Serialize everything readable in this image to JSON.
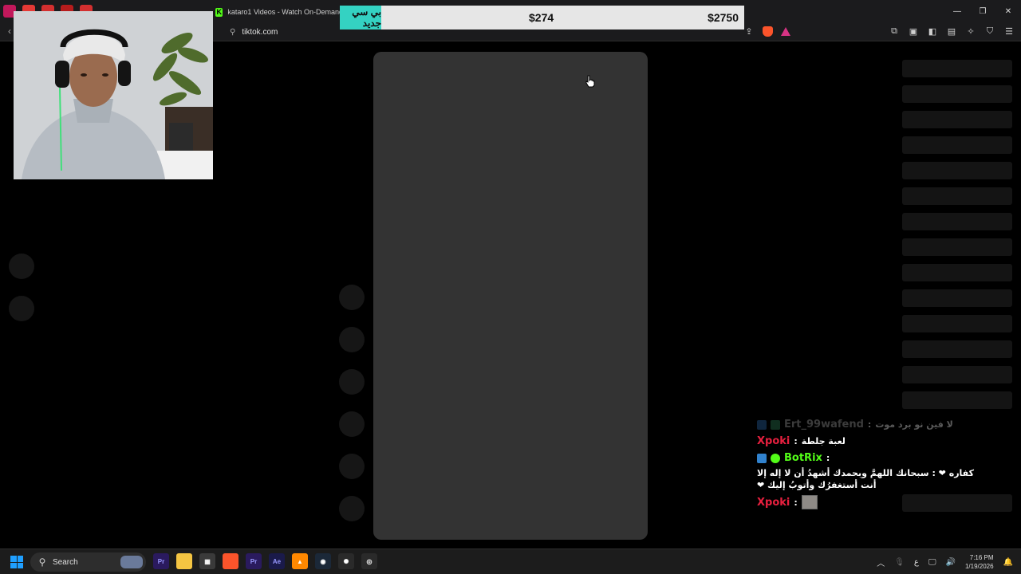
{
  "browser": {
    "active_tab_title": "kataro1 Videos - Watch On-Demand",
    "url": "tiktok.com"
  },
  "donation_bar": {
    "label": "بي سي جديد",
    "current": "$274",
    "goal": "$2750"
  },
  "chat": {
    "messages": [
      {
        "user": "Ert_99wafend",
        "text": "لا فين نو برد موت",
        "faded": true
      },
      {
        "user": "Xpoki",
        "text": "لعبة جلطة"
      },
      {
        "user": "BotRix",
        "text": "كفاره ❤ : سبحانك اللهمَّ وبحمدك أشهدُ أن لا إله إلا",
        "text2": "أنت أستغفرُك وأتوبُ إليك ❤"
      },
      {
        "user": "Xpoki",
        "text": ""
      }
    ]
  },
  "taskbar": {
    "search_label": "Search",
    "time": "7:16 PM",
    "date": "1/19/2026",
    "lang": "ع"
  },
  "colors": {
    "accent_teal": "#34d2c2",
    "kick_green": "#53fc18",
    "chat_red": "#e8203f"
  }
}
